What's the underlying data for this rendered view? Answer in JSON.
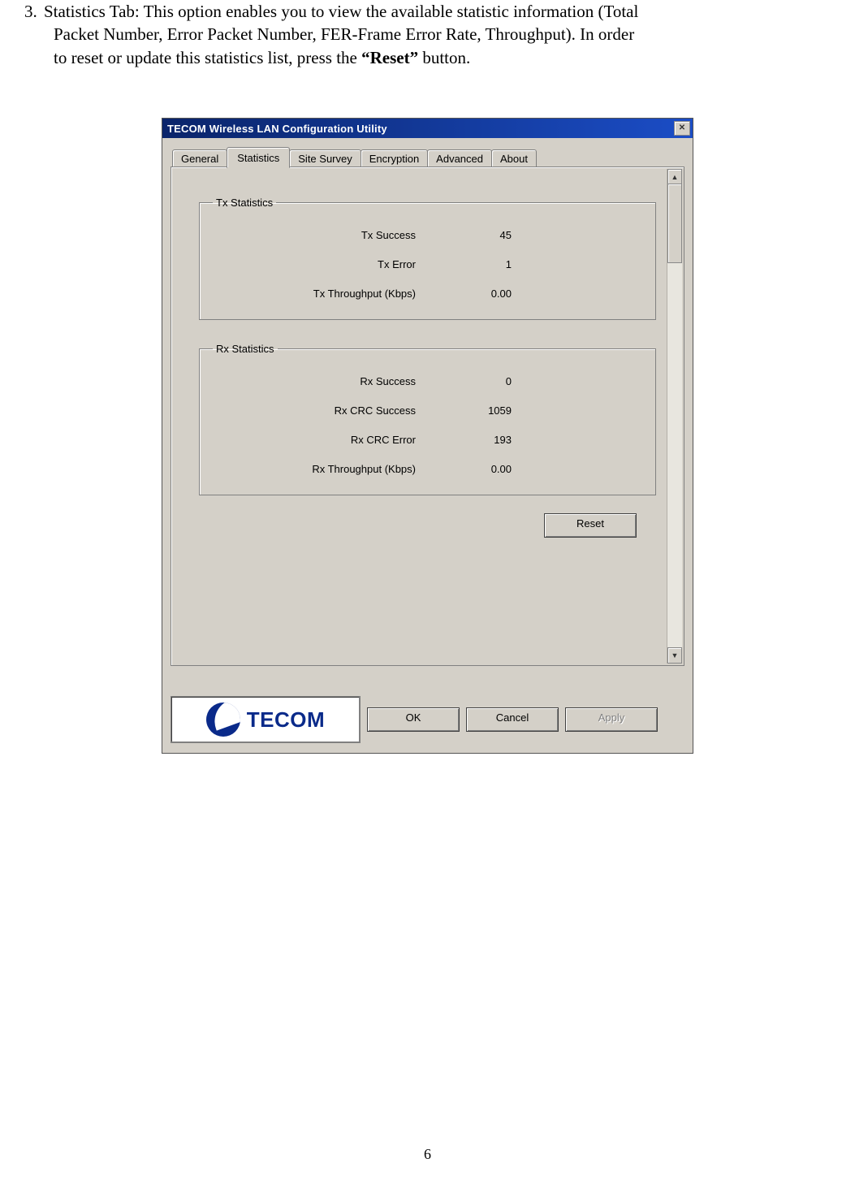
{
  "doc": {
    "item_number": "3.",
    "intro_p1": "Statistics Tab: This option enables you to view the available statistic information (Total",
    "intro_p2": "Packet Number, Error Packet Number, FER-Frame Error Rate, Throughput). In order",
    "intro_p3_a": "to reset or update this statistics list, press the ",
    "intro_bold": "“Reset”",
    "intro_p3_b": " button.",
    "page_number": "6"
  },
  "dialog": {
    "title": "TECOM Wireless LAN Configuration Utility",
    "close_glyph": "✕",
    "scroll_up_glyph": "▲",
    "scroll_down_glyph": "▼",
    "tabs": {
      "general": "General",
      "statistics": "Statistics",
      "site_survey": "Site Survey",
      "encryption": "Encryption",
      "advanced": "Advanced",
      "about": "About"
    },
    "tx_legend": "Tx Statistics",
    "rx_legend": "Rx Statistics",
    "tx": {
      "success_label": "Tx Success",
      "success_value": "45",
      "error_label": "Tx Error",
      "error_value": "1",
      "throughput_label": "Tx Throughput (Kbps)",
      "throughput_value": "0.00"
    },
    "rx": {
      "success_label": "Rx Success",
      "success_value": "0",
      "crc_success_label": "Rx CRC Success",
      "crc_success_value": "1059",
      "crc_error_label": "Rx CRC Error",
      "crc_error_value": "193",
      "throughput_label": "Rx Throughput (Kbps)",
      "throughput_value": "0.00"
    },
    "buttons": {
      "reset": "Reset",
      "ok": "OK",
      "cancel": "Cancel",
      "apply": "Apply"
    },
    "logo_text": "TECOM"
  }
}
